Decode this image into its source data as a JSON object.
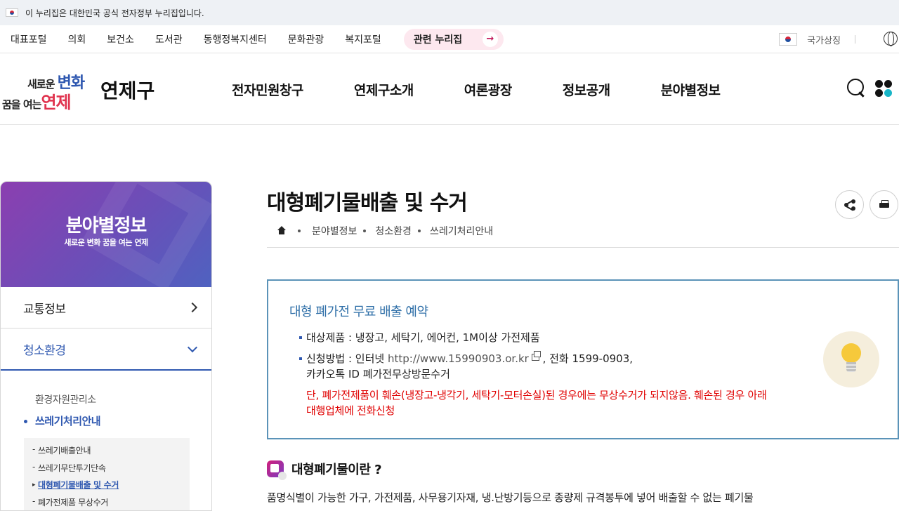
{
  "gov_banner": {
    "text": "이 누리집은 대한민국 공식 전자정부 누리집입니다."
  },
  "site_links": [
    "대표포털",
    "의회",
    "보건소",
    "도서관",
    "동행정복지센터",
    "문화관광",
    "복지포털"
  ],
  "related_button": {
    "label": "관련 누리집"
  },
  "national_symbol": {
    "label": "국가상징"
  },
  "logo": {
    "slogan_top_a": "새로운",
    "slogan_top_b": "변화",
    "slogan_bot_a": "꿈을 여는",
    "slogan_bot_b": "연제",
    "name": "연제구"
  },
  "gnb": [
    "전자민원창구",
    "연제구소개",
    "여론광장",
    "정보공개",
    "분야별정보"
  ],
  "lnb": {
    "title": "분야별정보",
    "subtitle": "새로운 변화 꿈을 여는 연제",
    "items": [
      {
        "label": "교통정보"
      },
      {
        "label": "청소환경"
      }
    ],
    "depth3": [
      "환경자원관리소",
      "쓰레기처리안내"
    ],
    "depth4": [
      "쓰레기배출안내",
      "쓰레기무단투기단속",
      "대형폐기물배출 및 수거",
      "폐가전제품 무상수거"
    ]
  },
  "page": {
    "title": "대형폐기물배출 및 수거",
    "breadcrumb": [
      "분야별정보",
      "청소환경",
      "쓰레기처리안내"
    ]
  },
  "notice": {
    "title": "대형 폐가전 무료 배출 예약",
    "item1": "대상제품 : 냉장고, 세탁기, 에어컨, 1M이상 가전제품",
    "item2_prefix": "신청방법 : 인터넷 ",
    "item2_url": "http://www.15990903.or.kr",
    "item2_suffix": " , 전화 1599-0903,",
    "item2_line2": "카카오톡 ID 폐가전무상방문수거",
    "warning": "단, 폐가전제품이 훼손(냉장고-냉각기, 세탁기-모터손실)된 경우에는 무상수거가 되지않음. 훼손된 경우 아래 대행업체에 전화신청"
  },
  "section": {
    "title": "대형폐기물이란 ?",
    "text": "품명식별이 가능한 가구, 가전제품, 사무용기자재, 냉.난방기등으로 종량제 규격봉투에 넣어 배출할 수 없는 폐기물"
  },
  "colors": {
    "accent": "#2f58b0",
    "warning": "#e00000",
    "notice_border": "#5b93b8"
  }
}
